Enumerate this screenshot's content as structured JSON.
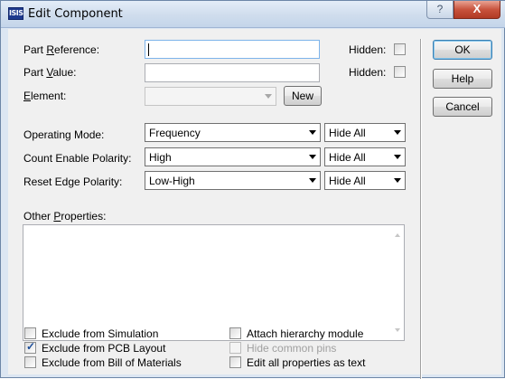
{
  "window": {
    "title": "Edit Component",
    "app_icon_text": "ISIS",
    "help_glyph": "?",
    "close_glyph": "X"
  },
  "fields": {
    "part_reference": {
      "label_pre": "Part ",
      "label_key": "R",
      "label_post": "eference:",
      "value": "",
      "hidden_label": "Hidden:"
    },
    "part_value": {
      "label_pre": "Part ",
      "label_key": "V",
      "label_post": "alue:",
      "value": "",
      "hidden_label": "Hidden:"
    },
    "element": {
      "label_key": "E",
      "label_post": "lement:",
      "value": "",
      "new_button": "New"
    }
  },
  "properties": [
    {
      "label": "Operating Mode:",
      "value": "Frequency",
      "visibility": "Hide All"
    },
    {
      "label": "Count Enable Polarity:",
      "value": "High",
      "visibility": "Hide All"
    },
    {
      "label": "Reset Edge Polarity:",
      "value": "Low-High",
      "visibility": "Hide All"
    }
  ],
  "other_properties": {
    "label_pre": "Other ",
    "label_key": "P",
    "label_post": "roperties:",
    "value": ""
  },
  "buttons": {
    "ok": "OK",
    "help": "Help",
    "cancel": "Cancel"
  },
  "options": {
    "exclude_simulation": {
      "label": "Exclude from Simulation",
      "checked": false
    },
    "exclude_pcb": {
      "label": "Exclude from PCB Layout",
      "checked": true
    },
    "exclude_bom": {
      "label": "Exclude from Bill of Materials",
      "checked": false
    },
    "attach_hierarchy": {
      "label": "Attach hierarchy module",
      "checked": false
    },
    "hide_common_pins": {
      "label": "Hide common pins",
      "checked": false,
      "enabled": false
    },
    "edit_all_as_text": {
      "label": "Edit all properties as text",
      "checked": false
    }
  },
  "check_glyph": "✓"
}
